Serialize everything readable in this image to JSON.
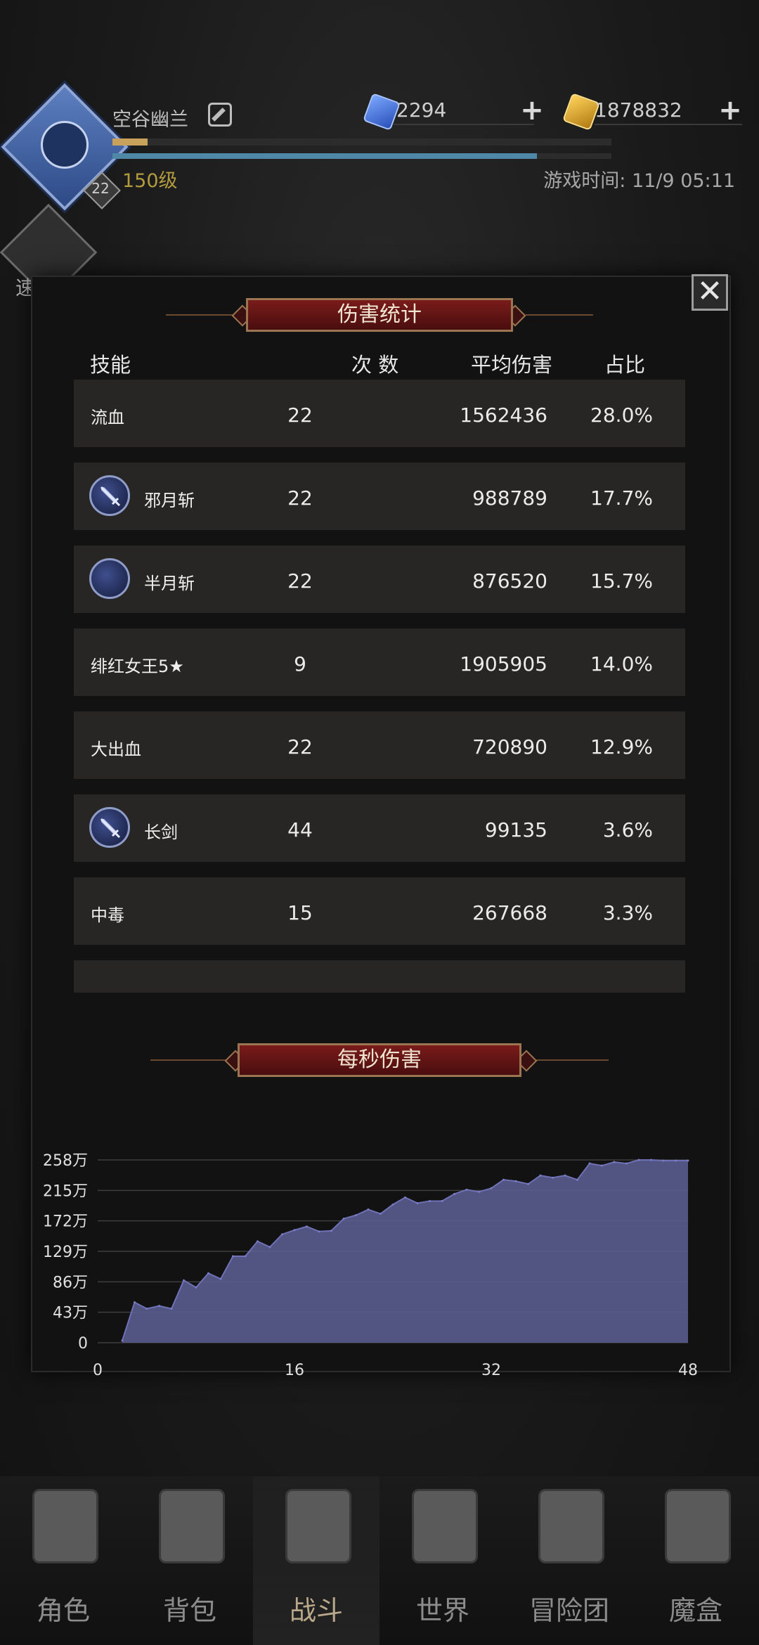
{
  "header": {
    "player_name": "空谷幽兰",
    "avatar_badge": "22",
    "level": "150级",
    "diamonds": "2294",
    "gold": "1878832",
    "game_time": "游戏时间: 11/9 05:11",
    "battle_label": "速 战",
    "xp_fraction": 0.07,
    "hp_fraction": 0.85
  },
  "modal": {
    "title": "伤害统计",
    "columns": [
      "技能",
      "次 数",
      "平均伤害",
      "占比"
    ],
    "rows": [
      {
        "name": "流血",
        "count": "22",
        "avg": "1562436",
        "pct": "28.0%",
        "icon": null
      },
      {
        "name": "邪月斩",
        "count": "22",
        "avg": "988789",
        "pct": "17.7%",
        "icon": "sword-icon"
      },
      {
        "name": "半月斩",
        "count": "22",
        "avg": "876520",
        "pct": "15.7%",
        "icon": "crescent-moon-icon"
      },
      {
        "name": "绯红女王5★",
        "count": "9",
        "avg": "1905905",
        "pct": "14.0%",
        "icon": null
      },
      {
        "name": "大出血",
        "count": "22",
        "avg": "720890",
        "pct": "12.9%",
        "icon": null
      },
      {
        "name": "长剑",
        "count": "44",
        "avg": "99135",
        "pct": "3.6%",
        "icon": "sword-icon"
      },
      {
        "name": "中毒",
        "count": "15",
        "avg": "267668",
        "pct": "3.3%",
        "icon": null
      },
      {
        "name": "",
        "count": "",
        "avg": "",
        "pct": "",
        "icon": null
      }
    ],
    "dps_title": "每秒伤害"
  },
  "chart_data": {
    "type": "area",
    "title": "",
    "xlabel": "",
    "ylabel": "",
    "x_ticks": [
      "0",
      "16",
      "32",
      "48"
    ],
    "y_ticks": [
      "0",
      "43万",
      "86万",
      "129万",
      "172万",
      "215万",
      "258万"
    ],
    "xlim": [
      0,
      48
    ],
    "ylim": [
      0,
      258
    ],
    "grid": true,
    "color": "#5a5c8f",
    "x": [
      2,
      3,
      4,
      5,
      6,
      7,
      8,
      9,
      10,
      11,
      12,
      13,
      14,
      15,
      16,
      17,
      18,
      19,
      20,
      21,
      22,
      23,
      24,
      25,
      26,
      27,
      28,
      29,
      30,
      31,
      32,
      33,
      34,
      35,
      36,
      37,
      38,
      39,
      40,
      41,
      42,
      43,
      44,
      45,
      46,
      47,
      48
    ],
    "values": [
      3,
      57,
      48,
      52,
      48,
      88,
      78,
      98,
      90,
      122,
      122,
      143,
      135,
      153,
      159,
      164,
      157,
      158,
      175,
      180,
      188,
      182,
      195,
      205,
      197,
      200,
      200,
      210,
      216,
      213,
      218,
      230,
      228,
      224,
      236,
      233,
      236,
      230,
      253,
      250,
      255,
      253,
      258,
      258,
      257,
      257,
      257
    ]
  },
  "nav": {
    "items": [
      {
        "label": "角色",
        "icon": "helmet-icon"
      },
      {
        "label": "背包",
        "icon": "backpack-icon"
      },
      {
        "label": "战斗",
        "icon": "sword-shield-icon"
      },
      {
        "label": "世界",
        "icon": "map-scroll-icon"
      },
      {
        "label": "冒险团",
        "icon": "castle-icon"
      },
      {
        "label": "魔盒",
        "icon": "magic-box-icon"
      }
    ],
    "active_index": 2
  }
}
